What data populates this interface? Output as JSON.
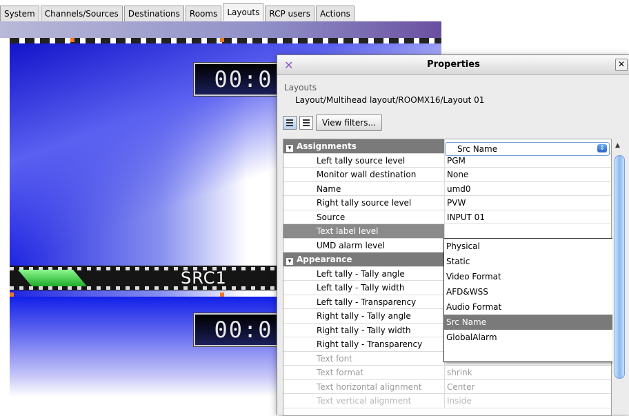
{
  "tabs": [
    {
      "label": "System"
    },
    {
      "label": "Channels/Sources"
    },
    {
      "label": "Destinations"
    },
    {
      "label": "Rooms"
    },
    {
      "label": "Layouts"
    },
    {
      "label": "RCP users"
    },
    {
      "label": "Actions"
    }
  ],
  "active_tab": "Layouts",
  "layout_preview": {
    "clock_top": "00:0",
    "clock_bottom": "00:0",
    "umd_label": "SRC1"
  },
  "dialog": {
    "title": "Properties",
    "breadcrumb_label": "Layouts",
    "breadcrumb_path": "Layout/Multihead layout/ROOMX16/Layout 01",
    "view_filters_label": "View filters..."
  },
  "properties": {
    "categories": [
      {
        "name": "Assignments",
        "rows": [
          {
            "key": "Left tally source level",
            "value": "PGM"
          },
          {
            "key": "Monitor wall destination",
            "value": "None"
          },
          {
            "key": "Name",
            "value": "umd0"
          },
          {
            "key": "Right tally source level",
            "value": "PVW"
          },
          {
            "key": "Source",
            "value": "INPUT 01"
          },
          {
            "key": "Text label level",
            "value": "Src Name"
          },
          {
            "key": "UMD alarm level",
            "value": ""
          }
        ]
      },
      {
        "name": "Appearance",
        "rows": [
          {
            "key": "Left tally - Tally angle",
            "value": ""
          },
          {
            "key": "Left tally - Tally width",
            "value": ""
          },
          {
            "key": "Left tally - Transparency",
            "value": ""
          },
          {
            "key": "Right tally - Tally angle",
            "value": ""
          },
          {
            "key": "Right tally - Tally width",
            "value": ""
          },
          {
            "key": "Right tally - Transparency",
            "value": ""
          },
          {
            "key": "Text font",
            "value": ""
          },
          {
            "key": "Text format",
            "value": "shrink"
          },
          {
            "key": "Text horizontal alignment",
            "value": "Center"
          },
          {
            "key": "Text vertical alignment",
            "value": "Inside"
          }
        ]
      }
    ]
  },
  "text_label_dropdown": {
    "selected": "Src Name",
    "options": [
      "Physical",
      "Static",
      "Video Format",
      "AFD&WSS",
      "Audio Format",
      "Src Name",
      "GlobalAlarm"
    ]
  }
}
